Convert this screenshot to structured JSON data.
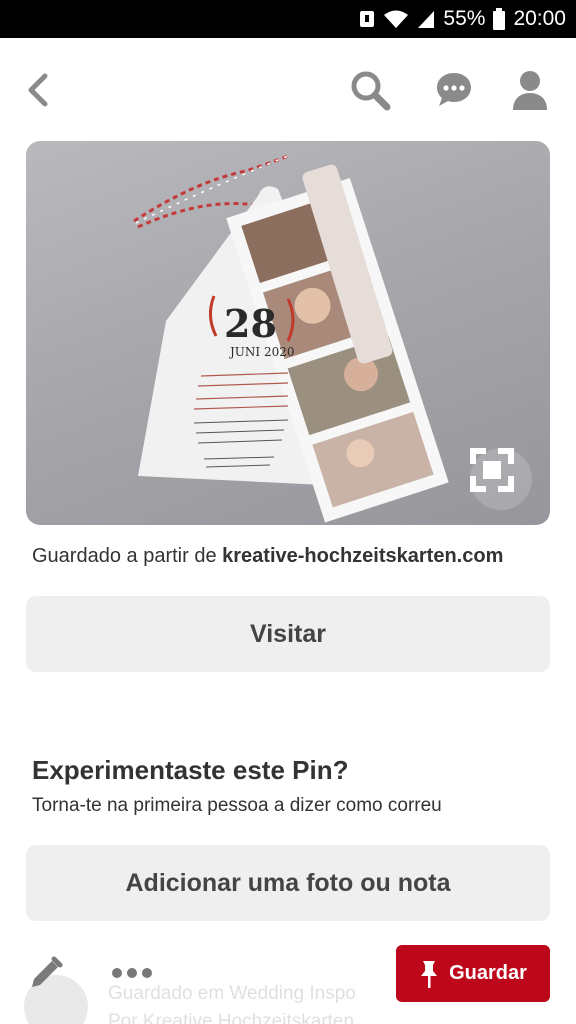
{
  "status_bar": {
    "battery_percent": "55%",
    "time": "20:00",
    "icons": [
      "notification-icon",
      "wifi-icon",
      "signal-icon",
      "battery-icon"
    ]
  },
  "nav": {
    "icons": [
      "back-arrow-icon",
      "search-icon",
      "chat-bubble-icon",
      "profile-icon"
    ]
  },
  "pin": {
    "invitation_day": "28",
    "invitation_month_year": "JUNI 2020"
  },
  "source": {
    "prefix": "Guardado a partir de",
    "domain": "kreative-hochzeitskarten.com"
  },
  "visit_button": {
    "label": "Visitar"
  },
  "tried": {
    "title": "Experimentaste este Pin?",
    "subtitle": "Torna-te na primeira pessoa a dizer como correu"
  },
  "add_photo_button": {
    "label": "Adicionar uma foto ou nota"
  },
  "bottom": {
    "save_label": "Guardar",
    "faded_line1": "Guardado em Wedding Inspo",
    "faded_line2": "Por Kreative Hochzeitskarten"
  },
  "colors": {
    "save_red": "#bd081c",
    "button_gray": "#efefef",
    "icon_gray": "#8a8a8a"
  }
}
